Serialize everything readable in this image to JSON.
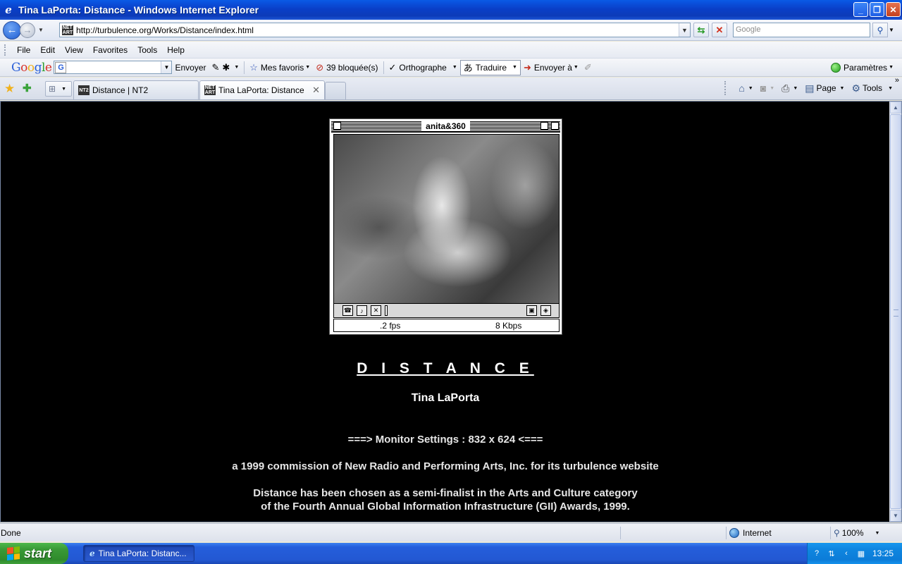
{
  "window": {
    "title": "Tina LaPorta: Distance - Windows Internet Explorer",
    "minimize_icon": "minimize-icon",
    "maximize_icon": "restore-icon",
    "close_icon": "close-icon"
  },
  "address": {
    "url": "http://turbulence.org/Works/Distance/index.html",
    "search_placeholder": "Google"
  },
  "menu": {
    "items": [
      "File",
      "Edit",
      "View",
      "Favorites",
      "Tools",
      "Help"
    ]
  },
  "google_toolbar": {
    "logo": "Google",
    "send_label": "Envoyer",
    "favorites_label": "Mes favoris",
    "blocked_label": "39 bloquée(s)",
    "spelling_label": "Orthographe",
    "translate_label": "Traduire",
    "send_to_label": "Envoyer à",
    "settings_label": "Paramètres"
  },
  "tabs": [
    {
      "label": "Distance | NT2",
      "icon": "NT2"
    },
    {
      "label": "Tina LaPorta: Distance",
      "icon": "NET ART"
    }
  ],
  "command_bar": {
    "page_label": "Page",
    "tools_label": "Tools"
  },
  "cam_window": {
    "title": "anita&360",
    "fps": ".2 fps",
    "bitrate": "8 Kbps"
  },
  "page": {
    "title": "D I S T A N C E",
    "author": "Tina LaPorta",
    "monitor": "===> Monitor Settings : 832 x 624 <===",
    "commission": "a 1999 commission of New Radio and Performing Arts, Inc. for its turbulence website",
    "award_line1": "Distance has been chosen as a semi-finalist in the Arts and Culture category",
    "award_line2": "of the Fourth Annual Global Information Infrastructure (GII) Awards, 1999."
  },
  "status": {
    "text": "Done",
    "zone": "Internet",
    "zoom": "100%"
  },
  "taskbar": {
    "start_label": "start",
    "task_label": "Tina LaPorta: Distanc...",
    "clock": "13:25"
  }
}
